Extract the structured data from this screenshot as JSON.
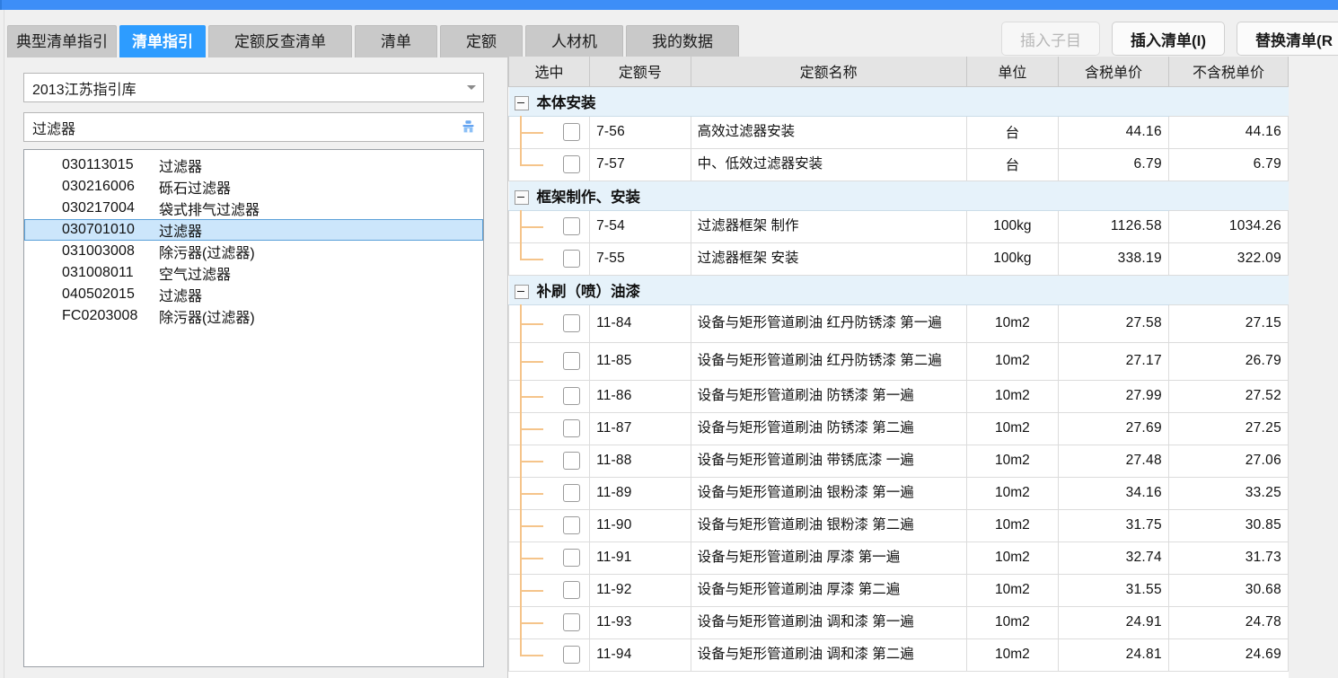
{
  "window": {
    "accent_color": "#3d8ef7"
  },
  "tabs": [
    {
      "label": "典型清单指引",
      "active": false
    },
    {
      "label": "清单指引",
      "active": true
    },
    {
      "label": "定额反查清单",
      "active": false
    },
    {
      "label": "清单",
      "active": false
    },
    {
      "label": "定额",
      "active": false
    },
    {
      "label": "人材机",
      "active": false
    },
    {
      "label": "我的数据",
      "active": false
    }
  ],
  "toolbar": {
    "insert_sub_item": "插入子目",
    "insert_list": "插入清单(I)",
    "replace_list": "替换清单(R"
  },
  "left_panel": {
    "library_select": {
      "value": "2013江苏指引库",
      "icon": "chevron-down-icon"
    },
    "search": {
      "value": "过滤器",
      "placeholder": "",
      "clear_icon": "broom-icon"
    },
    "results": [
      {
        "code": "030113015",
        "name": "过滤器",
        "selected": false
      },
      {
        "code": "030216006",
        "name": "砾石过滤器",
        "selected": false
      },
      {
        "code": "030217004",
        "name": "袋式排气过滤器",
        "selected": false
      },
      {
        "code": "030701010",
        "name": "过滤器",
        "selected": true
      },
      {
        "code": "031003008",
        "name": "除污器(过滤器)",
        "selected": false
      },
      {
        "code": "031008011",
        "name": "空气过滤器",
        "selected": false
      },
      {
        "code": "040502015",
        "name": "过滤器",
        "selected": false
      },
      {
        "code": "FC0203008",
        "name": "除污器(过滤器)",
        "selected": false
      }
    ]
  },
  "table": {
    "columns": [
      "选中",
      "定额号",
      "定额名称",
      "单位",
      "含税单价",
      "不含税单价"
    ],
    "groups": [
      {
        "title": "本体安装",
        "expanded": true,
        "rows": [
          {
            "checked": false,
            "code": "7-56",
            "name": "高效过滤器安装",
            "unit": "台",
            "tax_price": "44.16",
            "notax_price": "44.16"
          },
          {
            "checked": false,
            "code": "7-57",
            "name": "中、低效过滤器安装",
            "unit": "台",
            "tax_price": "6.79",
            "notax_price": "6.79"
          }
        ]
      },
      {
        "title": "框架制作、安装",
        "expanded": true,
        "rows": [
          {
            "checked": false,
            "code": "7-54",
            "name": "过滤器框架 制作",
            "unit": "100kg",
            "tax_price": "1126.58",
            "notax_price": "1034.26"
          },
          {
            "checked": false,
            "code": "7-55",
            "name": "过滤器框架 安装",
            "unit": "100kg",
            "tax_price": "338.19",
            "notax_price": "322.09"
          }
        ]
      },
      {
        "title": "补刷（喷）油漆",
        "expanded": true,
        "rows": [
          {
            "checked": false,
            "code": "11-84",
            "name": "设备与矩形管道刷油 红丹防锈漆 第一遍",
            "unit": "10m2",
            "tax_price": "27.58",
            "notax_price": "27.15",
            "tall": true
          },
          {
            "checked": false,
            "code": "11-85",
            "name": "设备与矩形管道刷油 红丹防锈漆 第二遍",
            "unit": "10m2",
            "tax_price": "27.17",
            "notax_price": "26.79",
            "tall": true
          },
          {
            "checked": false,
            "code": "11-86",
            "name": "设备与矩形管道刷油 防锈漆 第一遍",
            "unit": "10m2",
            "tax_price": "27.99",
            "notax_price": "27.52"
          },
          {
            "checked": false,
            "code": "11-87",
            "name": "设备与矩形管道刷油 防锈漆 第二遍",
            "unit": "10m2",
            "tax_price": "27.69",
            "notax_price": "27.25"
          },
          {
            "checked": false,
            "code": "11-88",
            "name": "设备与矩形管道刷油 带锈底漆 一遍",
            "unit": "10m2",
            "tax_price": "27.48",
            "notax_price": "27.06"
          },
          {
            "checked": false,
            "code": "11-89",
            "name": "设备与矩形管道刷油 银粉漆 第一遍",
            "unit": "10m2",
            "tax_price": "34.16",
            "notax_price": "33.25"
          },
          {
            "checked": false,
            "code": "11-90",
            "name": "设备与矩形管道刷油 银粉漆 第二遍",
            "unit": "10m2",
            "tax_price": "31.75",
            "notax_price": "30.85"
          },
          {
            "checked": false,
            "code": "11-91",
            "name": "设备与矩形管道刷油 厚漆 第一遍",
            "unit": "10m2",
            "tax_price": "32.74",
            "notax_price": "31.73"
          },
          {
            "checked": false,
            "code": "11-92",
            "name": "设备与矩形管道刷油 厚漆 第二遍",
            "unit": "10m2",
            "tax_price": "31.55",
            "notax_price": "30.68"
          },
          {
            "checked": false,
            "code": "11-93",
            "name": "设备与矩形管道刷油 调和漆 第一遍",
            "unit": "10m2",
            "tax_price": "24.91",
            "notax_price": "24.78"
          },
          {
            "checked": false,
            "code": "11-94",
            "name": "设备与矩形管道刷油 调和漆 第二遍",
            "unit": "10m2",
            "tax_price": "24.81",
            "notax_price": "24.69"
          }
        ]
      }
    ]
  }
}
